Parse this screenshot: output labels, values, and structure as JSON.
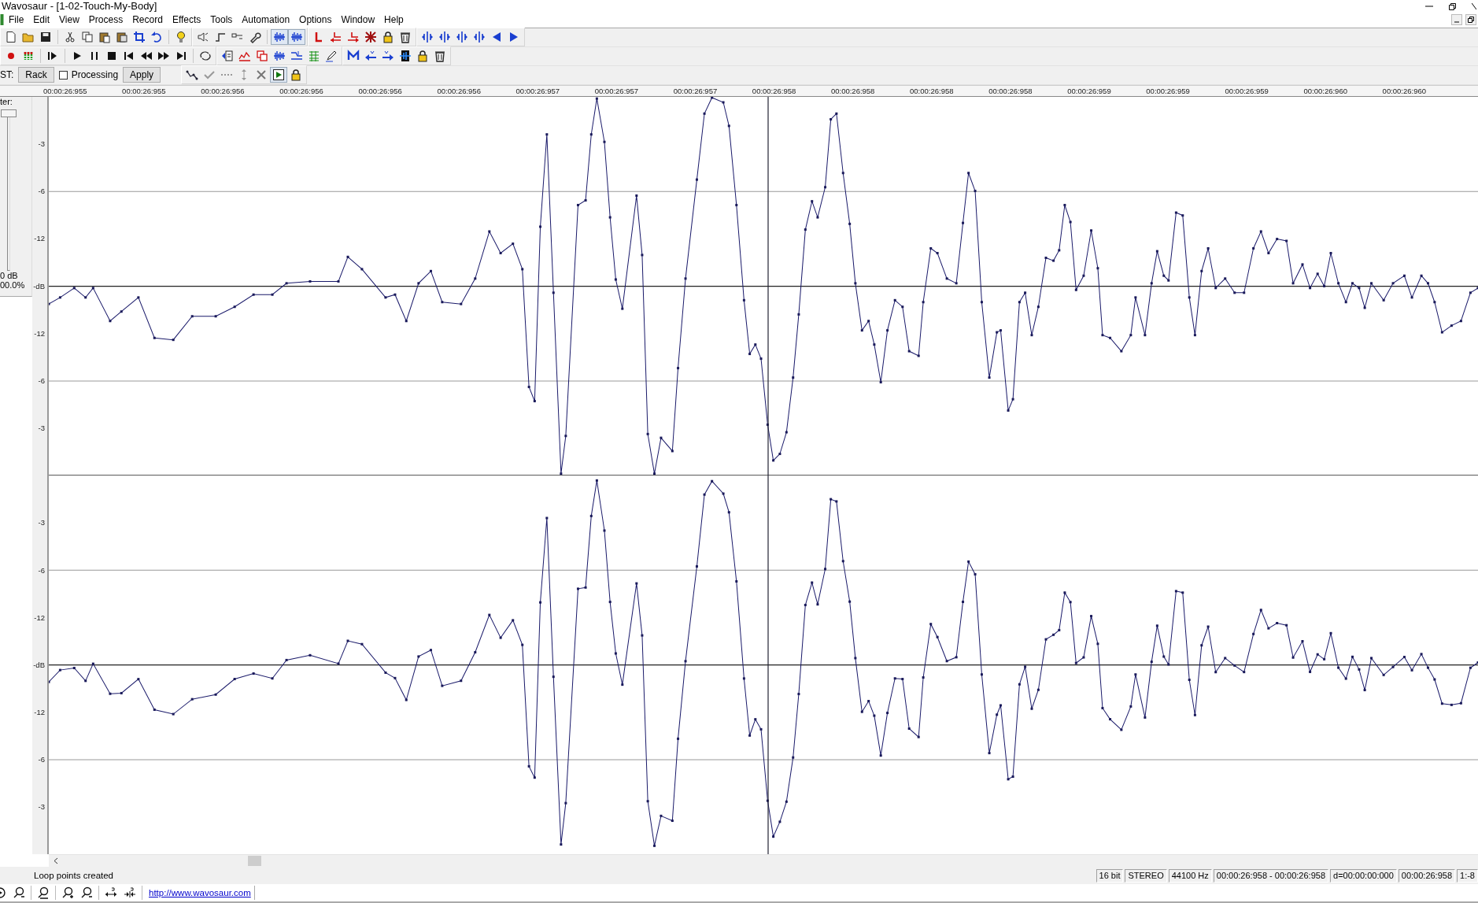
{
  "window": {
    "title": "Wavosaur - [1-02-Touch-My-Body]"
  },
  "menu": [
    "File",
    "Edit",
    "View",
    "Process",
    "Record",
    "Effects",
    "Tools",
    "Automation",
    "Options",
    "Window",
    "Help"
  ],
  "toolbar_toggles": [
    {
      "pressed": true
    },
    {
      "pressed": true
    }
  ],
  "vst": {
    "label": "ST:",
    "rack_button": "Rack",
    "processing": {
      "label": "Processing",
      "checked": false
    },
    "apply_button": "Apply",
    "snap_toggle": {
      "pressed": true
    }
  },
  "ruler": [
    "00:00:26:955",
    "00:00:26:955",
    "00:00:26:956",
    "00:00:26:956",
    "00:00:26:956",
    "00:00:26:956",
    "00:00:26:957",
    "00:00:26:957",
    "00:00:26:957",
    "00:00:26:958",
    "00:00:26:958",
    "00:00:26:958",
    "00:00:26:958",
    "00:00:26:959",
    "00:00:26:959",
    "00:00:26:959",
    "00:00:26:960",
    "00:00:26:960"
  ],
  "master": {
    "label": "ter:",
    "level": 1,
    "reading": "0 dB",
    "percent": "00.0%"
  },
  "channels": [
    {
      "scale": [
        "-3",
        "-6",
        "-12",
        "-dB",
        "-12",
        "-6",
        "-3"
      ]
    },
    {
      "scale": [
        "-3",
        "-6",
        "-12",
        "-dB",
        "-12",
        "-6",
        "-3"
      ]
    }
  ],
  "status": {
    "message": "Loop points created",
    "panes": [
      "16 bit",
      "STEREO",
      "44100 Hz",
      "00:00:26:958 - 00:00:26:958",
      "d=00:00:00:000",
      "00:00:26:958",
      "1:-8"
    ]
  },
  "link": "http://www.wavosaur.com"
}
